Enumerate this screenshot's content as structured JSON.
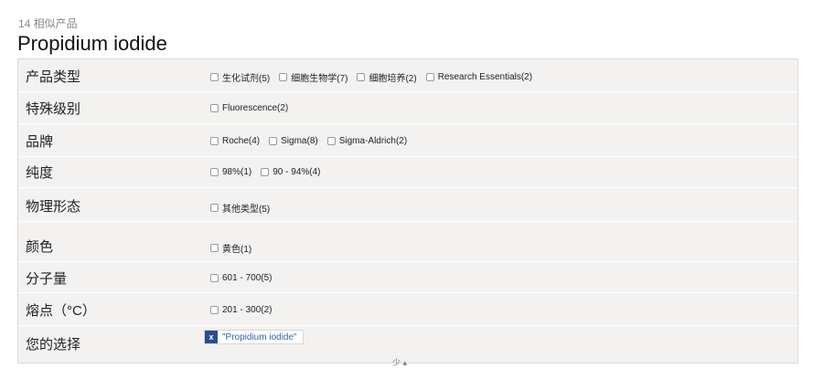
{
  "header": {
    "count_label": "14 相似产品",
    "title": "Propidium iodide"
  },
  "filters": [
    {
      "label": "产品类型",
      "options": [
        "生化试剂(5)",
        "细胞生物学(7)",
        "细胞培养(2)",
        "Research Essentials(2)"
      ]
    },
    {
      "label": "特殊级别",
      "options": [
        "Fluorescence(2)"
      ]
    },
    {
      "label": "品牌",
      "options": [
        "Roche(4)",
        "Sigma(8)",
        "Sigma-Aldrich(2)"
      ]
    },
    {
      "label": "纯度",
      "options": [
        "98%(1)",
        "90 - 94%(4)"
      ]
    },
    {
      "label": "物理形态",
      "options": [
        "其他类型(5)"
      ]
    },
    {
      "label": "颜色",
      "options": [
        "黄色(1)"
      ]
    },
    {
      "label": "分子量",
      "options": [
        "601 - 700(5)"
      ]
    },
    {
      "label": "熔点（°C）",
      "options": [
        "201 - 300(2)"
      ]
    }
  ],
  "selection": {
    "label": "您的选择",
    "remove_glyph": "x",
    "selected": "\"Propidium iodide\""
  },
  "collapse": {
    "label": "少",
    "icon": "caret-up-icon",
    "glyph": "▴"
  },
  "colors": {
    "panel_bg": "#f3f2f1",
    "title": "#111111",
    "remove_badge": "#2a4e8f",
    "selected_text": "#3366aa"
  }
}
